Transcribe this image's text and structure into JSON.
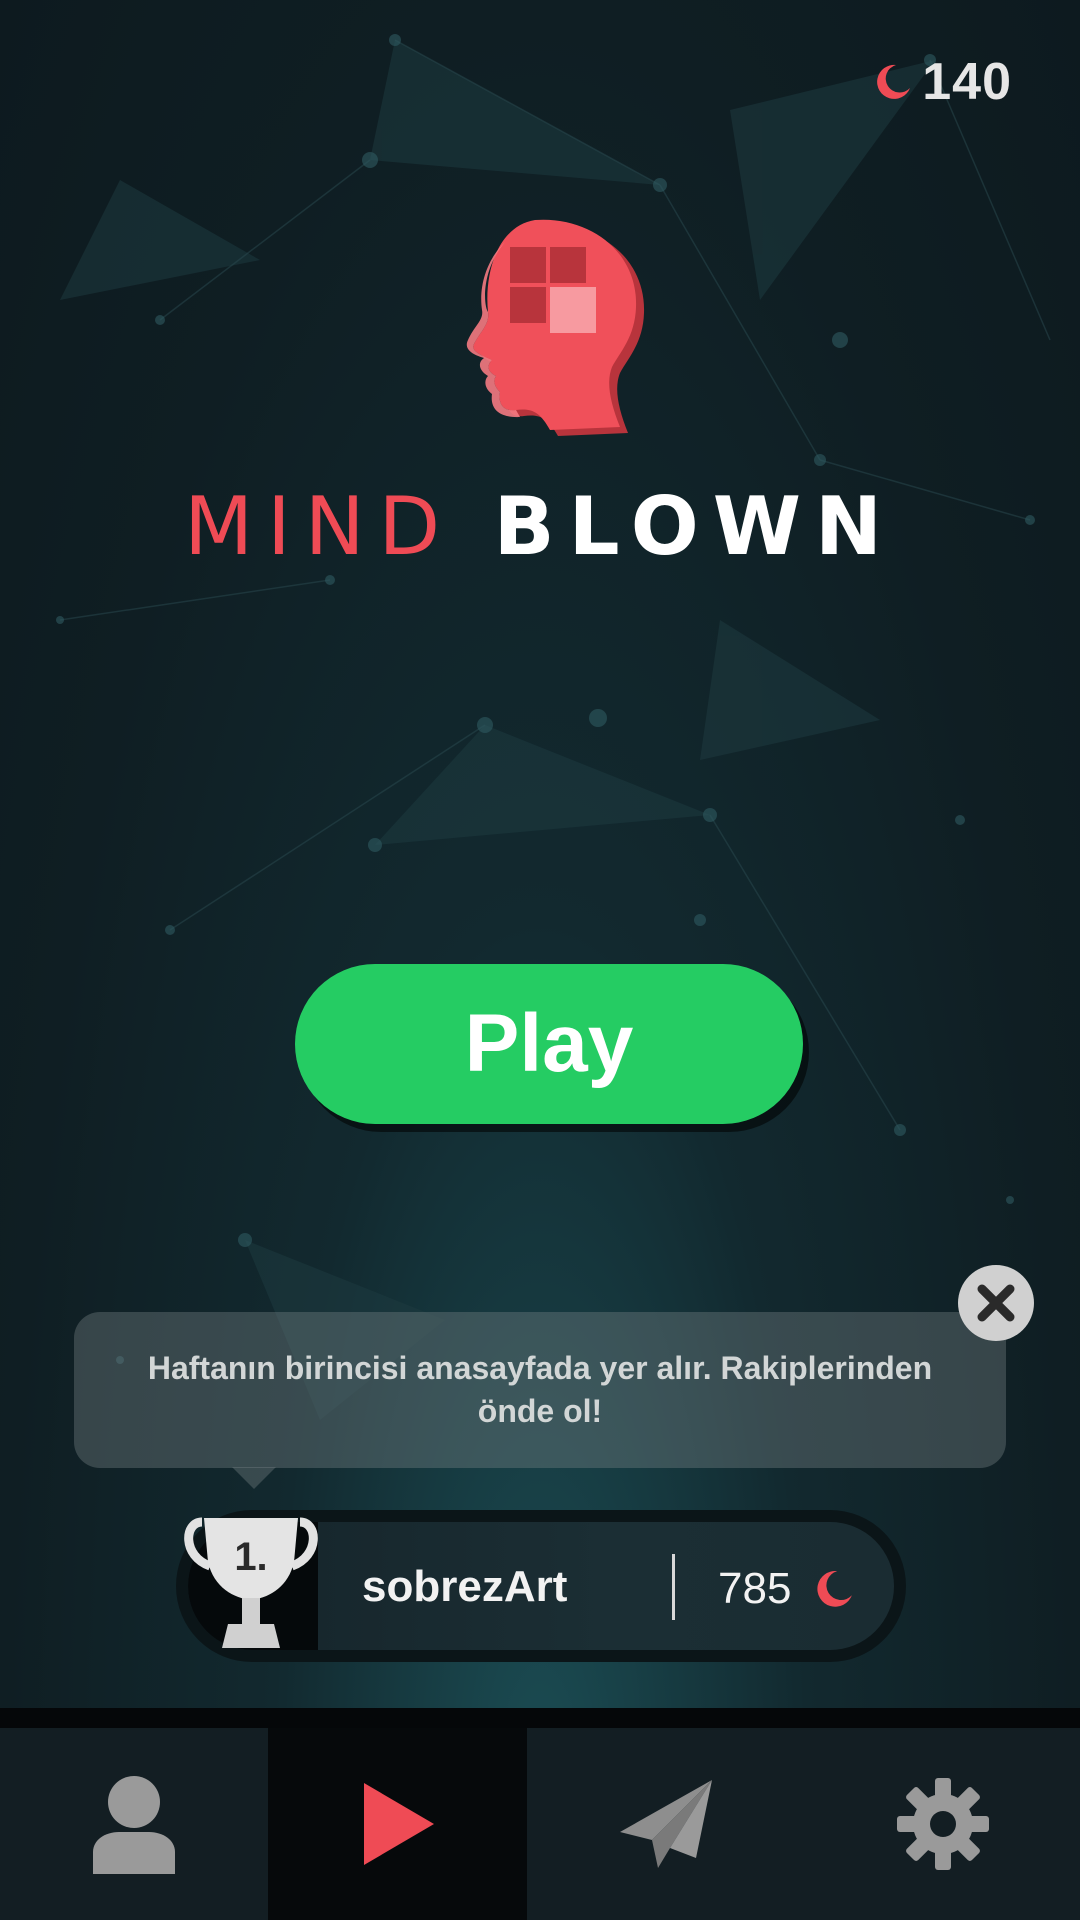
{
  "currency": {
    "value": "140",
    "icon": "moon-icon",
    "color": "#ef4b55"
  },
  "logo": {
    "icon": "brain-head-icon"
  },
  "title": {
    "word1": "MIND",
    "word2": "BLOWN"
  },
  "play_button": {
    "label": "Play",
    "color": "#25cc63"
  },
  "tooltip": {
    "text": "Haftanın birincisi anasayfada yer alır. Rakiplerinden önde ol!",
    "close_icon": "close-icon"
  },
  "leader": {
    "rank": "1.",
    "name": "sobrezArt",
    "score": "785",
    "icon": "trophy-icon"
  },
  "nav": {
    "items": [
      {
        "name": "profile",
        "icon": "user-icon",
        "active": false
      },
      {
        "name": "play",
        "icon": "play-icon",
        "active": true
      },
      {
        "name": "send",
        "icon": "paper-plane-icon",
        "active": false
      },
      {
        "name": "settings",
        "icon": "gear-icon",
        "active": false
      }
    ]
  }
}
